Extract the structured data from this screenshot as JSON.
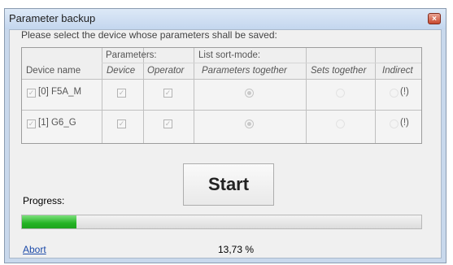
{
  "window": {
    "title": "Parameter backup",
    "close_glyph": "×"
  },
  "instruction": "Please select the device whose parameters shall be saved:",
  "table": {
    "group_headers": {
      "parameters": "Parameters:",
      "sort_mode": "List sort-mode:"
    },
    "columns": {
      "device_name": "Device name",
      "device": "Device",
      "operator": "Operator",
      "parameters_together": "Parameters together",
      "sets_together": "Sets together",
      "indirect": "Indirect"
    },
    "rows": [
      {
        "name": "[0] F5A_M",
        "selected": true,
        "device": true,
        "operator": true,
        "sort_mode": "parameters_together",
        "indirect_note": "(!)"
      },
      {
        "name": "[1] G6_G",
        "selected": true,
        "device": true,
        "operator": true,
        "sort_mode": "parameters_together",
        "indirect_note": "(!)"
      }
    ]
  },
  "start_label": "Start",
  "progress": {
    "label": "Progress:",
    "value_fraction": 0.1373,
    "text": "13,73 %"
  },
  "abort_label": "Abort",
  "check_glyph": "✓",
  "colors": {
    "progress_green": "#24b324",
    "link_blue": "#1c4aa8"
  }
}
